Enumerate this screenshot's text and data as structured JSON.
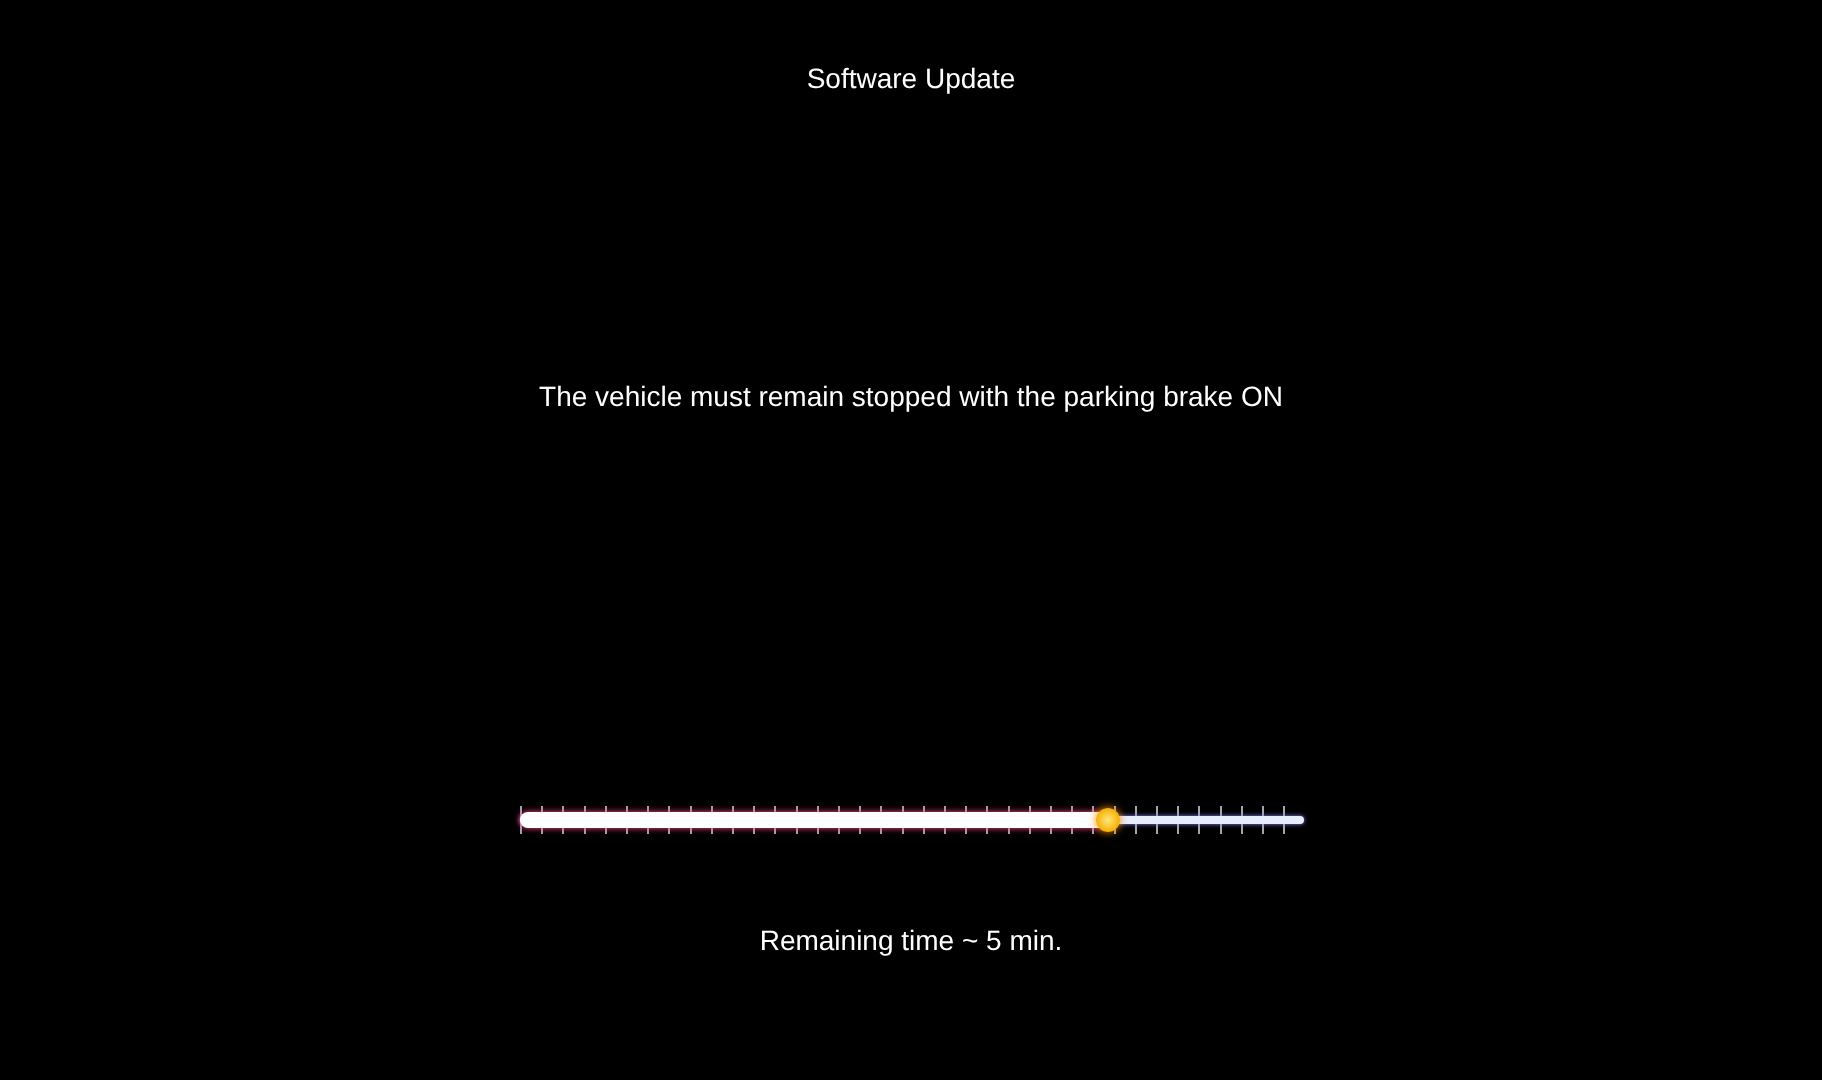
{
  "title": "Software Update",
  "message": "The vehicle must remain stopped with the parking brake ON",
  "progress": {
    "level": 0.75
  },
  "remaining": "Remaining time ~ 5 min."
}
